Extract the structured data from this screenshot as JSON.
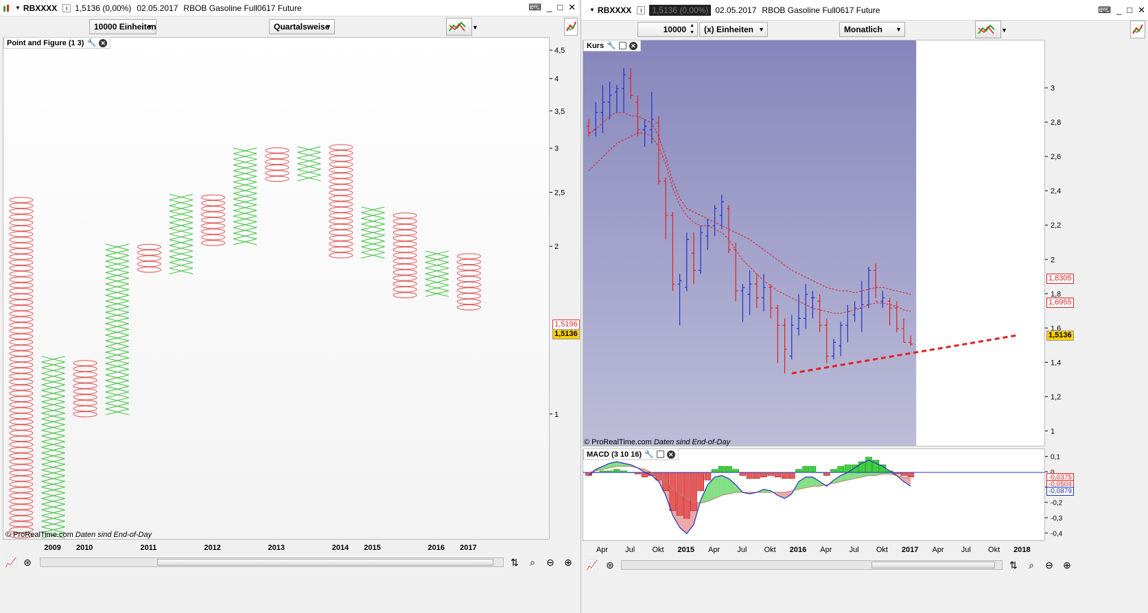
{
  "left": {
    "title": {
      "symbol": "RBXXXX",
      "price": "1,5136 (0,00%)",
      "date": "02.05.2017",
      "name": "RBOB Gasoline Full0617 Future"
    },
    "toolbar": {
      "units": "10000 Einheiten",
      "period": "Quartalsweise"
    },
    "panel_label": "Point and Figure (1 3)",
    "copyright": "© ProRealTime.com",
    "eod": "Daten sind End-of-Day",
    "badges": {
      "upper": "1,5196",
      "current": "1,5136"
    },
    "colors": {
      "x": "#3fbf3f",
      "o": "#e05050"
    }
  },
  "right": {
    "title": {
      "symbol": "RBXXXX",
      "price": "1,5136 (0,00%)",
      "date": "02.05.2017",
      "name": "RBOB Gasoline Full0617 Future"
    },
    "toolbar": {
      "qty": "10000",
      "units": "(x) Einheiten",
      "period": "Monatlich"
    },
    "price_label": "Kurs",
    "macd_label": "MACD (3 10 16)",
    "copyright": "© ProRealTime.com",
    "eod": "Daten sind End-of-Day",
    "badges": {
      "ma1": "1,8305",
      "ma2": "1,6955",
      "current": "1,5136",
      "macd1": "-0,0375",
      "macd2": "-0,0504",
      "macd3": "-0,0879"
    },
    "colors": {
      "up": "#1f2fd0",
      "down": "#e02020",
      "ma": "#e02020",
      "bg_top": "#8686bd",
      "bg_bottom": "#bdbdd8"
    }
  },
  "chart_data": [
    {
      "type": "point_and_figure",
      "title": "Point and Figure (1 3)",
      "y_scale": "log",
      "y_ticks": [
        "4,5",
        "4",
        "3,5",
        "3",
        "2,5",
        "2",
        "1"
      ],
      "x_ticks": [
        "2009",
        "2010",
        "2011",
        "2012",
        "2013",
        "2014",
        "2015",
        "2016",
        "2017"
      ],
      "columns": [
        {
          "kind": "O",
          "high": 2.44,
          "low": 0.6
        },
        {
          "kind": "X",
          "high": 1.26,
          "low": 0.6
        },
        {
          "kind": "O",
          "high": 1.25,
          "low": 0.99
        },
        {
          "kind": "X",
          "high": 2.01,
          "low": 1.0
        },
        {
          "kind": "O",
          "high": 2.0,
          "low": 1.8
        },
        {
          "kind": "X",
          "high": 2.47,
          "low": 1.79
        },
        {
          "kind": "O",
          "high": 2.45,
          "low": 2.01
        },
        {
          "kind": "X",
          "high": 2.97,
          "low": 2.02
        },
        {
          "kind": "O",
          "high": 2.95,
          "low": 2.62
        },
        {
          "kind": "X",
          "high": 3.02,
          "low": 2.63
        },
        {
          "kind": "O",
          "high": 2.99,
          "low": 1.91
        },
        {
          "kind": "X",
          "high": 2.31,
          "low": 1.91
        },
        {
          "kind": "O",
          "high": 2.27,
          "low": 1.62
        },
        {
          "kind": "X",
          "high": 1.94,
          "low": 1.63
        },
        {
          "kind": "O",
          "high": 1.92,
          "low": 1.54
        }
      ]
    },
    {
      "type": "ohlc",
      "title": "Kurs",
      "y_ticks": [
        "3",
        "2,8",
        "2,6",
        "2,4",
        "2,2",
        "2",
        "1,8",
        "1,6",
        "1,4",
        "1,2",
        "1"
      ],
      "x_ticks": [
        "Apr",
        "Jul",
        "Okt",
        "2015",
        "Apr",
        "Jul",
        "Okt",
        "2016",
        "Apr",
        "Jul",
        "Okt",
        "2017",
        "Apr",
        "Jul",
        "Okt",
        "2018"
      ],
      "bars": [
        {
          "o": 2.78,
          "h": 2.82,
          "l": 2.72,
          "c": 2.74
        },
        {
          "o": 2.76,
          "h": 2.92,
          "l": 2.72,
          "c": 2.86
        },
        {
          "o": 2.86,
          "h": 3.02,
          "l": 2.74,
          "c": 2.92
        },
        {
          "o": 2.92,
          "h": 3.04,
          "l": 2.82,
          "c": 2.96
        },
        {
          "o": 2.98,
          "h": 3.02,
          "l": 2.86,
          "c": 3.0
        },
        {
          "o": 3.0,
          "h": 3.12,
          "l": 2.86,
          "c": 3.08
        },
        {
          "o": 3.06,
          "h": 3.12,
          "l": 2.94,
          "c": 2.96
        },
        {
          "o": 2.92,
          "h": 2.96,
          "l": 2.72,
          "c": 2.76
        },
        {
          "o": 2.76,
          "h": 2.82,
          "l": 2.66,
          "c": 2.78
        },
        {
          "o": 2.76,
          "h": 2.98,
          "l": 2.68,
          "c": 2.82
        },
        {
          "o": 2.8,
          "h": 2.84,
          "l": 2.44,
          "c": 2.46
        },
        {
          "o": 2.46,
          "h": 2.48,
          "l": 2.12,
          "c": 2.26
        },
        {
          "o": 2.26,
          "h": 2.28,
          "l": 1.82,
          "c": 1.86
        },
        {
          "o": 1.86,
          "h": 1.92,
          "l": 1.62,
          "c": 1.88
        },
        {
          "o": 1.84,
          "h": 2.16,
          "l": 1.82,
          "c": 2.12
        },
        {
          "o": 2.04,
          "h": 2.16,
          "l": 1.86,
          "c": 1.94
        },
        {
          "o": 1.94,
          "h": 2.2,
          "l": 1.92,
          "c": 2.16
        },
        {
          "o": 2.14,
          "h": 2.24,
          "l": 2.06,
          "c": 2.2
        },
        {
          "o": 2.2,
          "h": 2.32,
          "l": 2.14,
          "c": 2.3
        },
        {
          "o": 2.26,
          "h": 2.38,
          "l": 2.18,
          "c": 2.34
        },
        {
          "o": 2.3,
          "h": 2.32,
          "l": 2.04,
          "c": 2.06
        },
        {
          "o": 2.06,
          "h": 2.1,
          "l": 1.76,
          "c": 1.82
        },
        {
          "o": 1.82,
          "h": 1.86,
          "l": 1.64,
          "c": 1.84
        },
        {
          "o": 1.8,
          "h": 1.94,
          "l": 1.68,
          "c": 1.86
        },
        {
          "o": 1.86,
          "h": 1.92,
          "l": 1.72,
          "c": 1.78
        },
        {
          "o": 1.78,
          "h": 1.92,
          "l": 1.7,
          "c": 1.84
        },
        {
          "o": 1.84,
          "h": 1.86,
          "l": 1.66,
          "c": 1.72
        },
        {
          "o": 1.72,
          "h": 1.74,
          "l": 1.4,
          "c": 1.62
        },
        {
          "o": 1.62,
          "h": 1.66,
          "l": 1.34,
          "c": 1.48
        },
        {
          "o": 1.44,
          "h": 1.68,
          "l": 1.42,
          "c": 1.62
        },
        {
          "o": 1.6,
          "h": 1.8,
          "l": 1.56,
          "c": 1.66
        },
        {
          "o": 1.66,
          "h": 1.86,
          "l": 1.6,
          "c": 1.8
        },
        {
          "o": 1.78,
          "h": 1.82,
          "l": 1.66,
          "c": 1.78
        },
        {
          "o": 1.76,
          "h": 1.8,
          "l": 1.58,
          "c": 1.62
        },
        {
          "o": 1.62,
          "h": 1.66,
          "l": 1.4,
          "c": 1.44
        },
        {
          "o": 1.44,
          "h": 1.54,
          "l": 1.42,
          "c": 1.52
        },
        {
          "o": 1.5,
          "h": 1.64,
          "l": 1.44,
          "c": 1.62
        },
        {
          "o": 1.62,
          "h": 1.74,
          "l": 1.52,
          "c": 1.7
        },
        {
          "o": 1.68,
          "h": 1.76,
          "l": 1.64,
          "c": 1.72
        },
        {
          "o": 1.72,
          "h": 1.88,
          "l": 1.58,
          "c": 1.74
        },
        {
          "o": 1.74,
          "h": 1.96,
          "l": 1.72,
          "c": 1.94
        },
        {
          "o": 1.94,
          "h": 1.98,
          "l": 1.78,
          "c": 1.76
        },
        {
          "o": 1.76,
          "h": 1.82,
          "l": 1.72,
          "c": 1.78
        },
        {
          "o": 1.76,
          "h": 1.78,
          "l": 1.62,
          "c": 1.72
        },
        {
          "o": 1.72,
          "h": 1.76,
          "l": 1.58,
          "c": 1.6
        },
        {
          "o": 1.6,
          "h": 1.66,
          "l": 1.52,
          "c": 1.52
        },
        {
          "o": 1.52,
          "h": 1.56,
          "l": 1.5,
          "c": 1.51
        }
      ],
      "ma1": [
        2.74,
        2.76,
        2.8,
        2.84,
        2.86,
        2.86,
        2.84,
        2.84,
        2.82,
        2.8,
        2.72,
        2.6,
        2.46,
        2.36,
        2.3,
        2.28,
        2.26,
        2.24,
        2.22,
        2.2,
        2.18,
        2.16,
        2.14,
        2.12,
        2.09,
        2.06,
        2.03,
        2.0,
        1.97,
        1.94,
        1.92,
        1.9,
        1.88,
        1.86,
        1.84,
        1.83,
        1.82,
        1.82,
        1.81,
        1.82,
        1.83,
        1.84,
        1.84,
        1.83,
        1.82,
        1.81,
        1.8
      ],
      "ma2": [
        2.52,
        2.56,
        2.6,
        2.64,
        2.68,
        2.7,
        2.72,
        2.74,
        2.74,
        2.72,
        2.66,
        2.56,
        2.42,
        2.32,
        2.26,
        2.22,
        2.2,
        2.2,
        2.18,
        2.16,
        2.12,
        2.06,
        2.0,
        1.96,
        1.92,
        1.88,
        1.85,
        1.82,
        1.8,
        1.78,
        1.76,
        1.74,
        1.72,
        1.71,
        1.7,
        1.69,
        1.69,
        1.7,
        1.71,
        1.72,
        1.74,
        1.75,
        1.75,
        1.74,
        1.73,
        1.71,
        1.7
      ],
      "trendline": {
        "from": {
          "bar": 29,
          "value": 1.34
        },
        "to": {
          "bar": 61,
          "value": 1.56
        }
      }
    },
    {
      "type": "macd",
      "title": "MACD (3 10 16)",
      "y_ticks": [
        "0,1",
        "0",
        "-0,1",
        "-0,2",
        "-0,3",
        "-0,4"
      ],
      "histogram": [
        -0.02,
        0.0,
        0.01,
        0.01,
        0.02,
        0.01,
        0.0,
        -0.01,
        -0.03,
        -0.02,
        -0.05,
        -0.12,
        -0.25,
        -0.28,
        -0.3,
        -0.25,
        -0.12,
        -0.05,
        0.02,
        0.04,
        0.04,
        0.02,
        -0.02,
        -0.04,
        -0.04,
        -0.03,
        -0.02,
        -0.03,
        -0.04,
        -0.04,
        0.02,
        0.04,
        0.04,
        0.0,
        -0.02,
        0.02,
        0.04,
        0.05,
        0.05,
        0.07,
        0.1,
        0.08,
        0.05,
        0.01,
        -0.01,
        -0.02,
        -0.03
      ],
      "macd": [
        -0.02,
        0.02,
        0.04,
        0.06,
        0.07,
        0.06,
        0.05,
        0.03,
        0.0,
        -0.02,
        -0.06,
        -0.15,
        -0.28,
        -0.36,
        -0.4,
        -0.34,
        -0.18,
        -0.08,
        -0.03,
        -0.02,
        -0.04,
        -0.08,
        -0.13,
        -0.14,
        -0.13,
        -0.11,
        -0.12,
        -0.15,
        -0.17,
        -0.14,
        -0.06,
        -0.03,
        -0.03,
        -0.06,
        -0.09,
        -0.05,
        -0.02,
        0.0,
        0.03,
        0.06,
        0.08,
        0.06,
        0.04,
        0.01,
        -0.02,
        -0.06,
        -0.09
      ],
      "signal": [
        0.0,
        0.01,
        0.02,
        0.03,
        0.04,
        0.04,
        0.04,
        0.03,
        0.02,
        0.0,
        -0.03,
        -0.06,
        -0.1,
        -0.14,
        -0.17,
        -0.19,
        -0.2,
        -0.19,
        -0.17,
        -0.15,
        -0.14,
        -0.13,
        -0.13,
        -0.13,
        -0.13,
        -0.13,
        -0.13,
        -0.13,
        -0.13,
        -0.12,
        -0.11,
        -0.1,
        -0.09,
        -0.09,
        -0.08,
        -0.07,
        -0.06,
        -0.05,
        -0.04,
        -0.03,
        -0.02,
        -0.02,
        -0.01,
        -0.01,
        -0.02,
        -0.03,
        -0.04
      ]
    }
  ]
}
